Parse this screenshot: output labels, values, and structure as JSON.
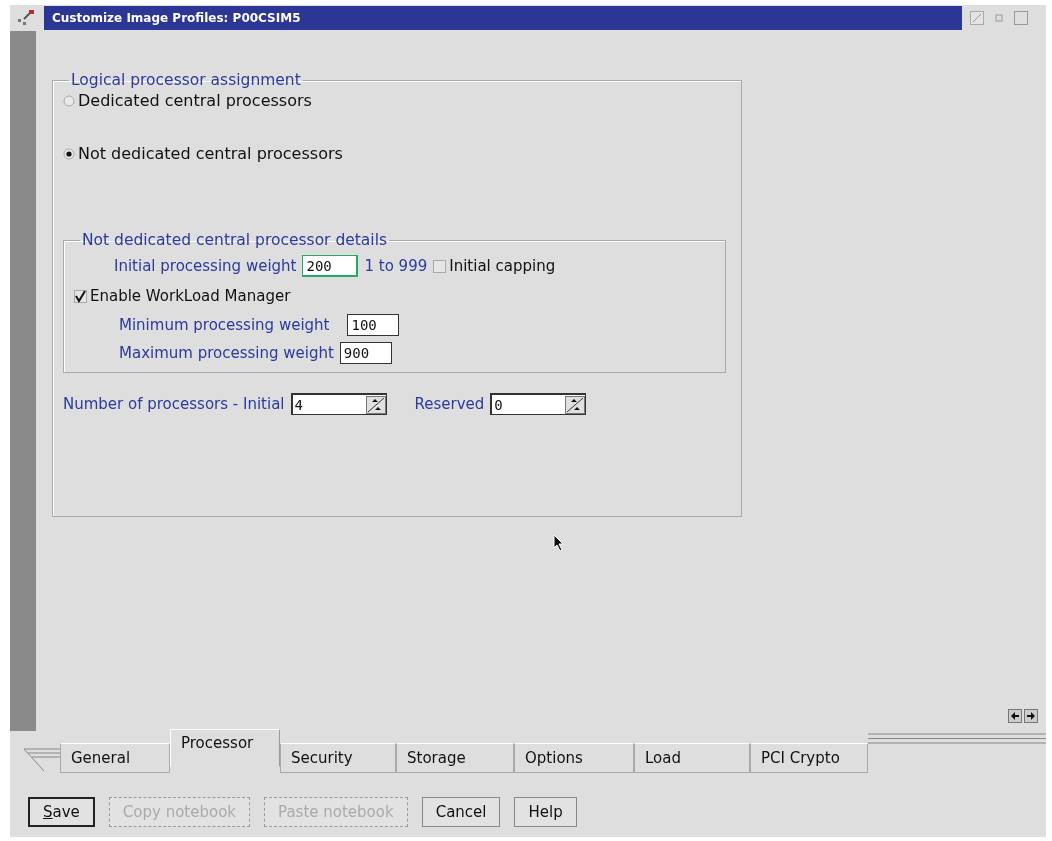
{
  "window": {
    "title": "Customize Image Profiles: P00CSIM5"
  },
  "assignment": {
    "legend": "Logical processor assignment",
    "options": [
      {
        "label": "Dedicated central processors",
        "selected": false
      },
      {
        "label": "Not dedicated central processors",
        "selected": true
      }
    ]
  },
  "details": {
    "legend": "Not dedicated central processor details",
    "initial_weight": {
      "label": "Initial processing weight",
      "value": "200",
      "range": "1 to 999"
    },
    "initial_capping": {
      "label": "Initial capping",
      "checked": false
    },
    "workload_manager": {
      "label": "Enable WorkLoad Manager",
      "checked": true
    },
    "minimum_weight": {
      "label": "Minimum processing weight",
      "value": "100"
    },
    "maximum_weight": {
      "label": "Maximum processing weight",
      "value": "900"
    }
  },
  "processors": {
    "initial_label": "Number of processors - Initial",
    "initial_value": "4",
    "reserved_label": "Reserved",
    "reserved_value": "0"
  },
  "tabs": [
    {
      "label": "General",
      "selected": false
    },
    {
      "label": "Processor",
      "selected": true
    },
    {
      "label": "Security",
      "selected": false
    },
    {
      "label": "Storage",
      "selected": false
    },
    {
      "label": "Options",
      "selected": false
    },
    {
      "label": "Load",
      "selected": false
    },
    {
      "label": "PCI Crypto",
      "selected": false
    }
  ],
  "buttons": [
    {
      "label": "Save",
      "disabled": false,
      "mnemonic": true
    },
    {
      "label": "Copy notebook",
      "disabled": true,
      "mnemonic": false
    },
    {
      "label": "Paste notebook",
      "disabled": true,
      "mnemonic": false
    },
    {
      "label": "Cancel",
      "disabled": false,
      "mnemonic": false
    },
    {
      "label": "Help",
      "disabled": false,
      "mnemonic": false
    }
  ]
}
